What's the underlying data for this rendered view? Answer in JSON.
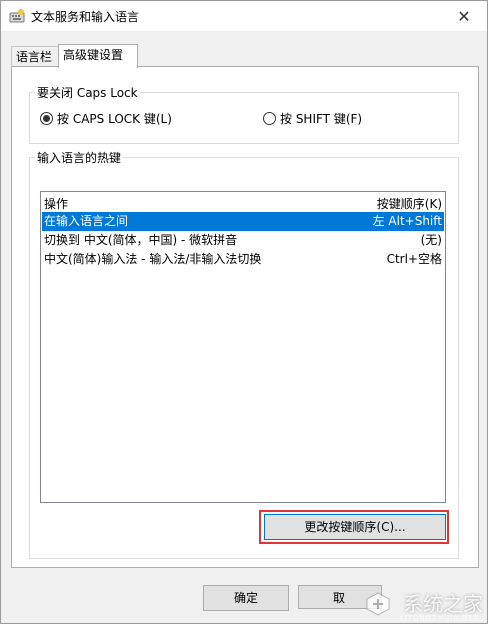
{
  "window": {
    "title": "文本服务和输入语言",
    "icons": {
      "app": "keyboard-settings-icon",
      "close": "close-icon"
    }
  },
  "tabs": [
    {
      "label": "语言栏",
      "active": false
    },
    {
      "label": "高级键设置",
      "active": true
    }
  ],
  "caps_lock": {
    "group_label": "要关闭 Caps Lock",
    "options": [
      {
        "label": "按 CAPS LOCK 键(L)",
        "checked": true
      },
      {
        "label": "按 SHIFT 键(F)",
        "checked": false
      }
    ]
  },
  "hotkeys": {
    "group_label": "输入语言的热键",
    "columns": [
      "操作",
      "按键顺序(K)"
    ],
    "rows": [
      {
        "action": "在输入语言之间",
        "keys": "左 Alt+Shift",
        "selected": true
      },
      {
        "action": "切换到 中文(简体，中国) - 微软拼音",
        "keys": "(无)",
        "selected": false
      },
      {
        "action": "中文(简体)输入法 - 输入法/非输入法切换",
        "keys": "Ctrl+空格",
        "selected": false
      }
    ],
    "change_button": "更改按键顺序(C)..."
  },
  "footer": {
    "ok": "确定",
    "cancel_partial": "取"
  },
  "watermark": {
    "text": "系统之家",
    "sub": "XITONGZHIJIA.NET"
  },
  "colors": {
    "selection": "#0078d7",
    "highlight_border": "#e0343b"
  }
}
